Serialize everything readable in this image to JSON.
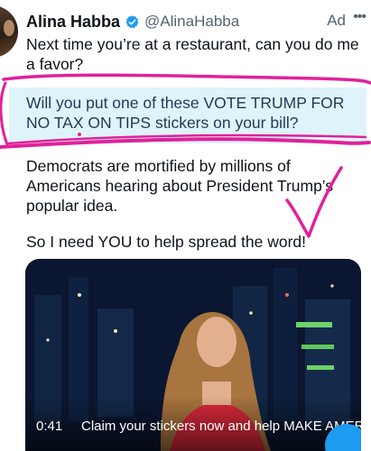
{
  "tweet": {
    "author_name": "Alina Habba",
    "handle": "@AlinaHabba",
    "ad_label": "Ad",
    "more_glyph": "•••",
    "paragraph_1": "Next time you’re at a restaurant, can you do me a favor?",
    "paragraph_2": "Will you put one of these VOTE TRUMP FOR NO TAX ON TIPS stickers on your bill?",
    "paragraph_3": "Democrats are mortified by millions of Americans hearing about President Trump’s popular idea.",
    "paragraph_4": "So I need YOU to help spread the word!"
  },
  "video": {
    "timestamp": "0:41",
    "caption": "Claim your stickers now and help MAKE AMER"
  },
  "colors": {
    "verified_badge": "#1d9bf0",
    "highlight_fill": "#dff3fb",
    "marker_magenta": "#e0219a",
    "muted_text": "#536471"
  },
  "icons": [
    "verified-badge-icon",
    "more-options-icon",
    "compose-fab-icon"
  ]
}
